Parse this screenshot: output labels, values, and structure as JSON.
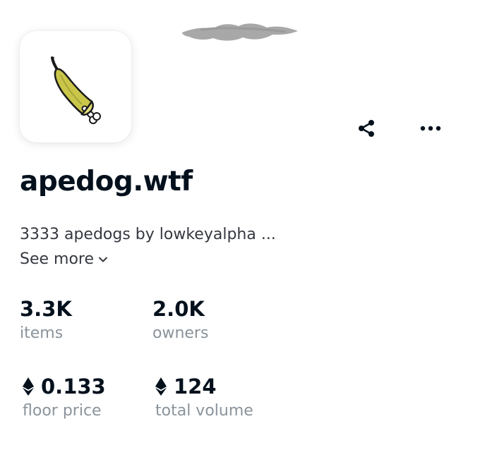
{
  "collection": {
    "name": "apedog.wtf",
    "description": "3333 apedogs by lowkeyalpha ...",
    "see_more_label": "See more"
  },
  "icons": {
    "share": "share-icon",
    "more": "more-horizontal-icon",
    "see_more": "chevron-down-icon",
    "currency": "ethereum-icon",
    "avatar": "banana-bone-icon"
  },
  "stats": {
    "items": {
      "value": "3.3K",
      "label": "items"
    },
    "owners": {
      "value": "2.0K",
      "label": "owners"
    },
    "floor_price": {
      "value": "0.133",
      "label": "floor price"
    },
    "total_volume": {
      "value": "124",
      "label": "total volume"
    }
  },
  "colors": {
    "text_primary": "#04111d",
    "text_secondary": "#8a939b",
    "banana_yellow": "#c9c64a"
  }
}
